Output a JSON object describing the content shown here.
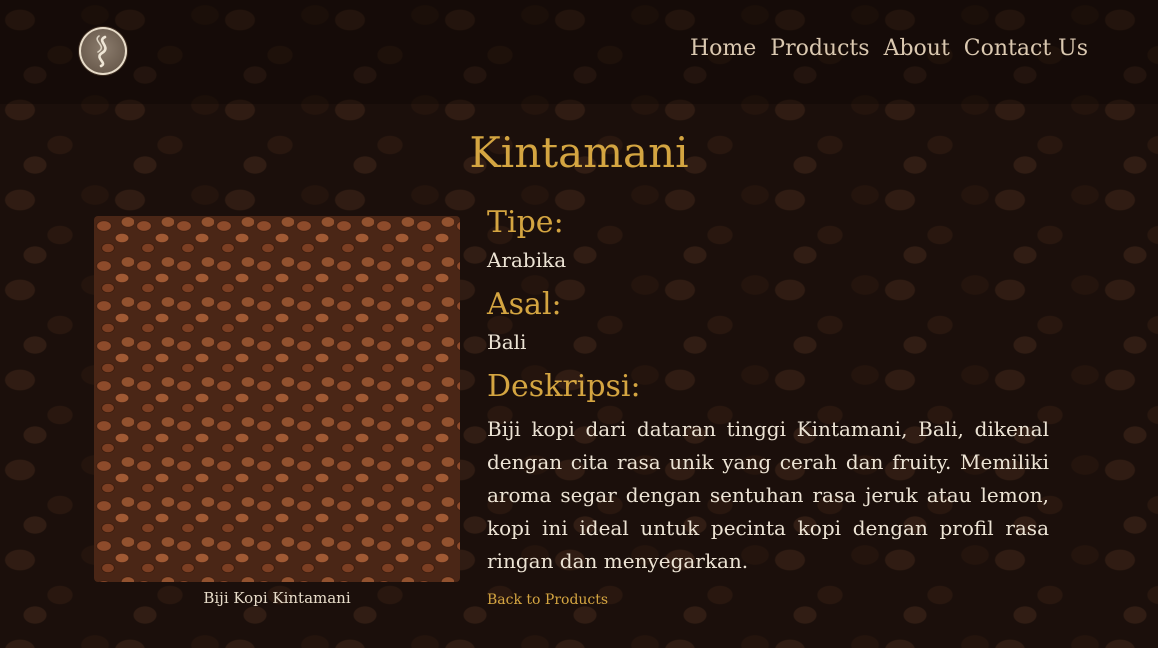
{
  "nav": {
    "items": [
      {
        "label": "Home"
      },
      {
        "label": "Products"
      },
      {
        "label": "About"
      },
      {
        "label": "Contact Us"
      }
    ]
  },
  "product": {
    "title": "Kintamani",
    "image_caption": "Biji Kopi Kintamani",
    "type_label": "Tipe:",
    "type_value": "Arabika",
    "origin_label": "Asal:",
    "origin_value": "Bali",
    "description_label": "Deskripsi:",
    "description": "Biji kopi dari dataran tinggi Kintamani, Bali, dikenal dengan cita rasa unik yang cerah dan fruity. Memiliki aroma segar dengan sentuhan rasa jeruk atau lemon, kopi ini ideal untuk pecinta kopi dengan profil rasa ringan dan menyegarkan."
  },
  "back_link": "Back to Products",
  "colors": {
    "accent": "#d4a541",
    "text": "#ece3d4",
    "nav_text": "#dac8b0"
  },
  "icons": {
    "logo": "coffee-bean-logo-icon"
  }
}
